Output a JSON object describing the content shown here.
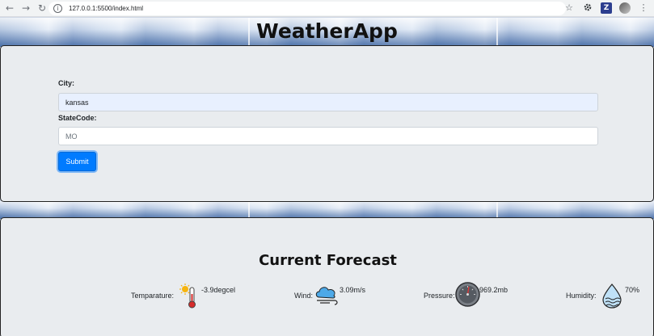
{
  "browser": {
    "back_icon": "←",
    "forward_icon": "→",
    "reload_icon": "↻",
    "info_icon": "i",
    "url": "127.0.0.1:5500/index.html",
    "star_icon": "☆",
    "ext_icon": "Z",
    "menu_icon": "⋮"
  },
  "header": {
    "title": "WeatherApp"
  },
  "form": {
    "city_label": "City:",
    "city_value": "kansas",
    "state_label": "StateCode:",
    "state_value": "MO",
    "submit_label": "Submit"
  },
  "forecast": {
    "title": "Current Forecast",
    "temperature": {
      "label": "Temparature:",
      "value": "-3.9degcel"
    },
    "wind": {
      "label": "Wind:",
      "value": "3.09m/s"
    },
    "pressure": {
      "label": "Pressure:",
      "value": "969.2mb"
    },
    "humidity": {
      "label": "Humidity:",
      "value": "70%"
    }
  },
  "colors": {
    "accent": "#007bff",
    "card_bg": "#e9ecef",
    "autofill_bg": "#e8f0fe"
  }
}
